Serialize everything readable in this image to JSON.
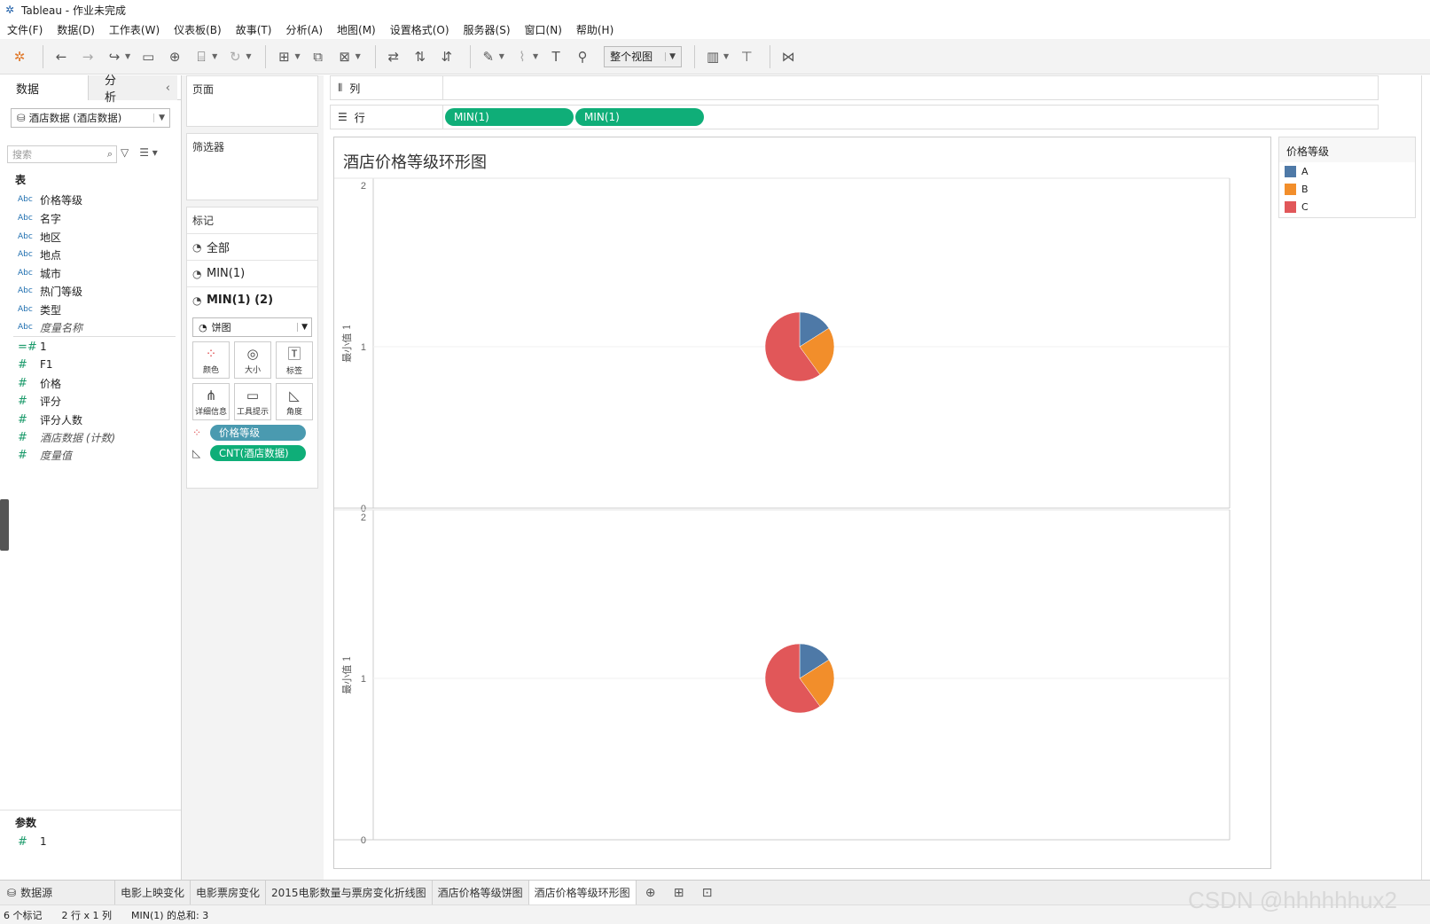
{
  "window": {
    "title": "Tableau - 作业未完成"
  },
  "menu": [
    "文件(F)",
    "数据(D)",
    "工作表(W)",
    "仪表板(B)",
    "故事(T)",
    "分析(A)",
    "地图(M)",
    "设置格式(O)",
    "服务器(S)",
    "窗口(N)",
    "帮助(H)"
  ],
  "toolbar": {
    "view_select": "整个视图"
  },
  "left_panel": {
    "tabs": [
      "数据",
      "分析"
    ],
    "datasource": "酒店数据 (酒店数据)",
    "search_placeholder": "搜索",
    "tables_title": "表",
    "dimensions": [
      {
        "type": "Abc",
        "name": "价格等级"
      },
      {
        "type": "Abc",
        "name": "名字"
      },
      {
        "type": "Abc",
        "name": "地区"
      },
      {
        "type": "Abc",
        "name": "地点"
      },
      {
        "type": "Abc",
        "name": "城市"
      },
      {
        "type": "Abc",
        "name": "热门等级"
      },
      {
        "type": "Abc",
        "name": "类型"
      },
      {
        "type": "Abc",
        "name": "度量名称"
      }
    ],
    "measures": [
      {
        "type": "=#",
        "name": "1"
      },
      {
        "type": "#",
        "name": "F1"
      },
      {
        "type": "#",
        "name": "价格"
      },
      {
        "type": "#",
        "name": "评分"
      },
      {
        "type": "#",
        "name": "评分人数"
      },
      {
        "type": "#",
        "name": "酒店数据 (计数)"
      },
      {
        "type": "#",
        "name": "度量值"
      }
    ],
    "params_title": "参数",
    "params": [
      {
        "type": "#",
        "name": "1"
      }
    ]
  },
  "shelves": {
    "pages": "页面",
    "filters": "筛选器",
    "marks": "标记",
    "columns_label": "列",
    "rows_label": "行",
    "rows_pills": [
      "MIN(1)",
      "MIN(1)"
    ]
  },
  "marks_card": {
    "rows": [
      "全部",
      "MIN(1)",
      "MIN(1) (2)"
    ],
    "mark_type": "饼图",
    "buttons": [
      "颜色",
      "大小",
      "标签",
      "详细信息",
      "工具提示",
      "角度"
    ],
    "pills": [
      "价格等级",
      "CNT(酒店数据)"
    ],
    "pill_colors": {
      "color": "#4a9ab0",
      "angle": "#0fae78"
    }
  },
  "viz": {
    "title": "酒店价格等级环形图",
    "panes": [
      {
        "axis_label": "最小值 1",
        "ticks": [
          "2",
          "1",
          "0"
        ]
      },
      {
        "axis_label": "最小值 1",
        "ticks": [
          "2",
          "1",
          "0"
        ]
      }
    ]
  },
  "chart_data": {
    "type": "pie",
    "categories": [
      "A",
      "B",
      "C"
    ],
    "values": [
      0.16,
      0.24,
      0.6
    ],
    "colors": [
      "#4e79a7",
      "#f28e2b",
      "#e15759"
    ],
    "ylim": [
      0,
      2
    ],
    "pie_y": 1,
    "panes": 2
  },
  "legend": {
    "title": "价格等级",
    "items": [
      {
        "label": "A",
        "color": "#4e79a7"
      },
      {
        "label": "B",
        "color": "#f28e2b"
      },
      {
        "label": "C",
        "color": "#e15759"
      }
    ]
  },
  "sheet_tabs": {
    "datasource": "数据源",
    "sheets": [
      "电影上映变化",
      "电影票房变化",
      "2015电影数量与票房变化折线图",
      "酒店价格等级饼图",
      "酒店价格等级环形图"
    ],
    "active": "酒店价格等级环形图"
  },
  "status": [
    "6 个标记",
    "2 行 x 1 列",
    "MIN(1) 的总和: 3"
  ],
  "watermark": "CSDN @hhhhhhux2"
}
